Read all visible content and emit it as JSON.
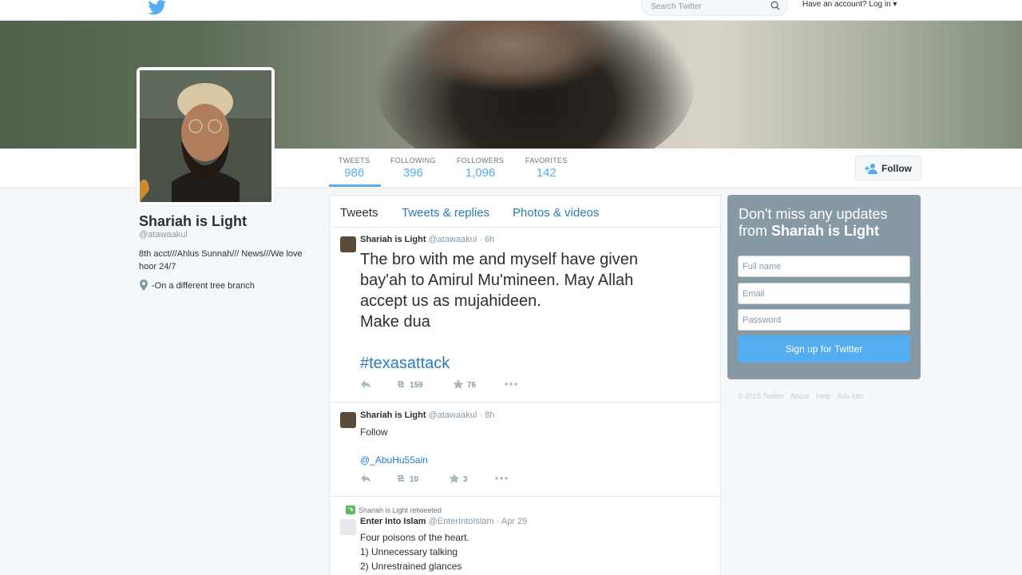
{
  "topbar": {
    "logo_icon": "twitter-bird-icon",
    "search_placeholder": "Search Twitter",
    "search_icon": "search-icon",
    "login_text": "Have an account? Log in ▾",
    "brand_color": "#55acee"
  },
  "profile": {
    "name": "Shariah is Light",
    "handle": "@atawaakul",
    "bio": "8th acct///Ahlus Sunnah/// News///We love hoor 24/7",
    "location": "-On a different tree branch"
  },
  "stats": [
    {
      "label": "TWEETS",
      "value": "986"
    },
    {
      "label": "FOLLOWING",
      "value": "396"
    },
    {
      "label": "FOLLOWERS",
      "value": "1,096"
    },
    {
      "label": "FAVORITES",
      "value": "142"
    }
  ],
  "follow_button": "Follow",
  "tabs": [
    "Tweets",
    "Tweets & replies",
    "Photos & videos"
  ],
  "tweets": [
    {
      "name": "Shariah is Light",
      "handle": "@atawaakul",
      "time": "· 6h",
      "lines": [
        "The bro with me and myself have given",
        "bay'ah to Amirul Mu'mineen. May Allah",
        "accept us as mujahideen.",
        "Make dua"
      ],
      "hashtag": "#texasattack",
      "retweets": "159",
      "favorites": "76"
    },
    {
      "name": "Shariah is Light",
      "handle": "@atawaakul",
      "time": "· 8h",
      "line1": "Follow",
      "mention": "@_AbuHu55ain",
      "retweets": "10",
      "favorites": "3"
    },
    {
      "retweet_note": "Shariah is Light retweeted",
      "name": "Enter Into Islam",
      "handle": "@EnterIntoIslam",
      "time": "· Apr 29",
      "lines": [
        "Four poisons of the heart.",
        "1) Unnecessary talking",
        "2) Unrestrained glances"
      ]
    }
  ],
  "signup": {
    "title_prefix": "Don't miss any updates from ",
    "title_name": "Shariah is Light",
    "fullname_placeholder": "Full name",
    "email_placeholder": "Email",
    "password_placeholder": "Password",
    "button": "Sign up for Twitter"
  },
  "footer": [
    "© 2015 Twitter",
    "About",
    "Help",
    "Ads info"
  ]
}
